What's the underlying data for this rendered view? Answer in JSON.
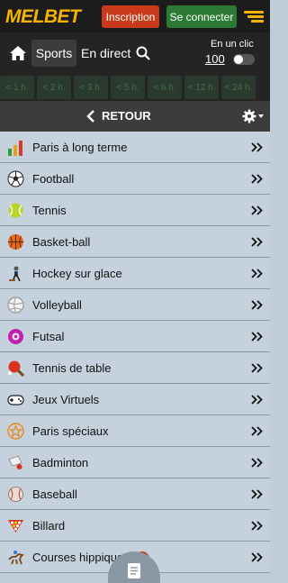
{
  "header": {
    "logo": "MELBET",
    "register_label": "Inscription",
    "login_label": "Se connecter"
  },
  "nav": {
    "sports_label": "Sports",
    "live_label": "En direct",
    "oneclick_label": "En un clic",
    "oneclick_amount": "100"
  },
  "time_filters": [
    "< 1 h.",
    "< 2 h.",
    "< 3 h.",
    "< 5 h.",
    "< 6 h.",
    "< 12 h.",
    "< 24 h."
  ],
  "subheader": {
    "back_label": "RETOUR"
  },
  "sports": [
    {
      "label": "Paris à long terme",
      "icon": "bar-chart-icon"
    },
    {
      "label": "Football",
      "icon": "soccer-ball-icon"
    },
    {
      "label": "Tennis",
      "icon": "tennis-ball-icon"
    },
    {
      "label": "Basket-ball",
      "icon": "basketball-icon"
    },
    {
      "label": "Hockey sur glace",
      "icon": "hockey-icon"
    },
    {
      "label": "Volleyball",
      "icon": "volleyball-icon"
    },
    {
      "label": "Futsal",
      "icon": "futsal-ball-icon"
    },
    {
      "label": "Tennis de table",
      "icon": "ping-pong-icon"
    },
    {
      "label": "Jeux Virtuels",
      "icon": "gamepad-icon"
    },
    {
      "label": "Paris spéciaux",
      "icon": "star-icon"
    },
    {
      "label": "Badminton",
      "icon": "shuttlecock-icon"
    },
    {
      "label": "Baseball",
      "icon": "baseball-icon"
    },
    {
      "label": "Billard",
      "icon": "billiard-icon"
    },
    {
      "label": "Courses hippiques",
      "icon": "horse-racing-icon",
      "badge": "0"
    }
  ],
  "colors": {
    "brand_yellow": "#f5b400",
    "register_red": "#c93a1a",
    "login_green": "#2c7a33",
    "row_bg": "#c5d1dc"
  }
}
